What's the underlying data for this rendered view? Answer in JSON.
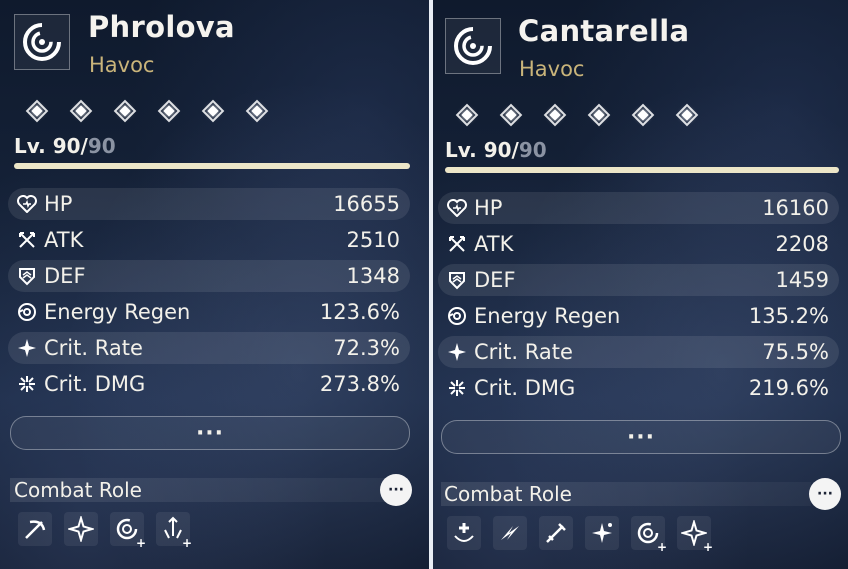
{
  "left": {
    "name": "Phrolova",
    "element": "Havoc",
    "level": {
      "current": "Lv. 90/",
      "max": "90",
      "progress": 1.0
    },
    "stats": [
      {
        "label": "HP",
        "value": "16655",
        "icon": "heart-icon"
      },
      {
        "label": "ATK",
        "value": "2510",
        "icon": "crossed-swords-icon"
      },
      {
        "label": "DEF",
        "value": "1348",
        "icon": "shield-icon"
      },
      {
        "label": "Energy Regen",
        "value": "123.6%",
        "icon": "energy-icon"
      },
      {
        "label": "Crit. Rate",
        "value": "72.3%",
        "icon": "crit-rate-icon"
      },
      {
        "label": "Crit. DMG",
        "value": "273.8%",
        "icon": "crit-dmg-icon"
      }
    ],
    "more_label": "···",
    "combat_role": {
      "title": "Combat Role",
      "button": "···",
      "roles": [
        "scythe-role-icon",
        "star-role-icon",
        "spiral-role-icon",
        "sword-boost-role-icon"
      ]
    }
  },
  "right": {
    "name": "Cantarella",
    "element": "Havoc",
    "level": {
      "current": "Lv. 90/",
      "max": "90",
      "progress": 1.0
    },
    "stats": [
      {
        "label": "HP",
        "value": "16160",
        "icon": "heart-icon"
      },
      {
        "label": "ATK",
        "value": "2208",
        "icon": "crossed-swords-icon"
      },
      {
        "label": "DEF",
        "value": "1459",
        "icon": "shield-icon"
      },
      {
        "label": "Energy Regen",
        "value": "135.2%",
        "icon": "energy-icon"
      },
      {
        "label": "Crit. Rate",
        "value": "75.5%",
        "icon": "crit-rate-icon"
      },
      {
        "label": "Crit. DMG",
        "value": "219.6%",
        "icon": "crit-dmg-icon"
      }
    ],
    "more_label": "···",
    "combat_role": {
      "title": "Combat Role",
      "button": "···",
      "roles": [
        "healing-role-icon",
        "dash-role-icon",
        "sword-role-icon",
        "sparkle-role-icon",
        "spiral-role-icon",
        "star-role-icon"
      ]
    }
  },
  "colors": {
    "element": "#c9b47a",
    "level_bar": "#ece6c8",
    "level_max": "#8b93a3"
  }
}
